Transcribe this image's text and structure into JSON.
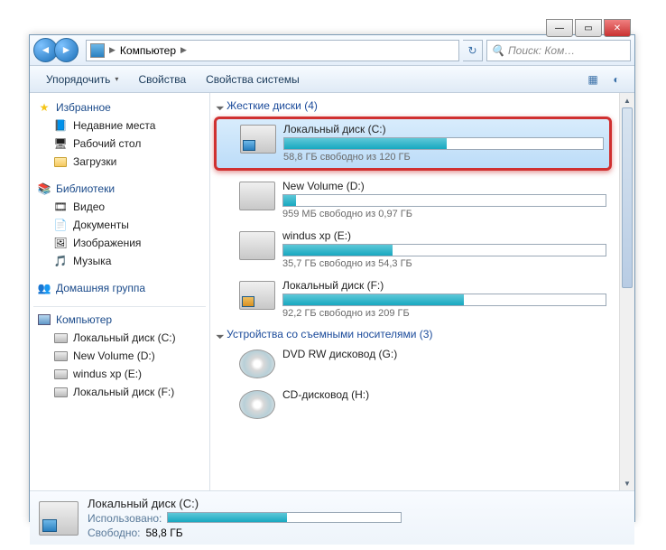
{
  "breadcrumb": {
    "item": "Компьютер"
  },
  "search": {
    "placeholder": "Поиск: Ком…"
  },
  "toolbar": {
    "organize": "Упорядочить",
    "properties": "Свойства",
    "sys_properties": "Свойства системы"
  },
  "sidebar": {
    "favorites": {
      "label": "Избранное",
      "items": [
        "Недавние места",
        "Рабочий стол",
        "Загрузки"
      ]
    },
    "libraries": {
      "label": "Библиотеки",
      "items": [
        "Видео",
        "Документы",
        "Изображения",
        "Музыка"
      ]
    },
    "homegroup": {
      "label": "Домашняя группа"
    },
    "computer": {
      "label": "Компьютер",
      "items": [
        "Локальный диск (C:)",
        "New Volume (D:)",
        "windus xp (E:)",
        "Локальный диск (F:)"
      ]
    }
  },
  "sections": {
    "hdd": "Жесткие диски (4)",
    "removable": "Устройства со съемными носителями (3)"
  },
  "drives": [
    {
      "name": "Локальный диск (C:)",
      "free": "58,8 ГБ свободно из 120 ГБ",
      "fill": 51,
      "highlight": true
    },
    {
      "name": "New Volume (D:)",
      "free": "959 МБ свободно из 0,97 ГБ",
      "fill": 4,
      "red": false
    },
    {
      "name": "windus xp (E:)",
      "free": "35,7 ГБ свободно из 54,3 ГБ",
      "fill": 34
    },
    {
      "name": "Локальный диск (F:)",
      "free": "92,2 ГБ свободно из 209 ГБ",
      "fill": 56
    }
  ],
  "removable": [
    {
      "name": "DVD RW дисковод (G:)"
    },
    {
      "name": "CD-дисковод (H:)"
    }
  ],
  "details": {
    "title": "Локальный диск (C:)",
    "used_label": "Использовано:",
    "free_label": "Свободно:",
    "free_value": "58,8 ГБ",
    "fill": 51
  }
}
